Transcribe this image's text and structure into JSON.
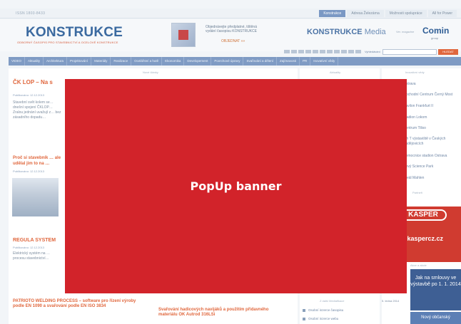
{
  "top": {
    "issn": "ISSN 1803-8433",
    "links": [
      "Konstrukce",
      "Adresa Železárna",
      "Možnosti spolupráce",
      "All for Power"
    ],
    "active_link_index": 0
  },
  "header": {
    "logo": "KONSTRUKCE",
    "logo_sub": "ODBORNÝ ČASOPIS PRO STAVEBNICTVÍ A OCELOVÉ KONSTRUKCE",
    "promo_text": "Objednávejte předplatné, tištěná vydání časopisu KONSTRUKCE",
    "promo_link": "OBJEDNAT »»",
    "media_brand": "KONSTRUKCE",
    "media_suffix": "Media",
    "partner_label": "Ver. magazine",
    "partner_logo": "Comin",
    "partner_sub": "group"
  },
  "search": {
    "extra_link": "Vyhledávání",
    "button": "HLEDAT",
    "placeholder": ""
  },
  "nav": {
    "items": [
      "VIDEO",
      "Aktuality",
      "Architektura",
      "Projektování",
      "Materiály",
      "Realizace",
      "Ocelářství a hutě",
      "Ekonomika",
      "Developement",
      "Povrchové úpravy",
      "Svařování a dělení",
      "Zajímavosti",
      "PR",
      "Inovativní vědy"
    ]
  },
  "main": {
    "section_label": "Nové články",
    "article1": {
      "title": "ČK LOP – Na s",
      "date": "Publikováno: 12.12.2013",
      "text": "Stavební svět kolem se… dnešní spojení ČKLOP… Zralou jednání uvažují z… bez zásadního dopadu…"
    },
    "article2": {
      "title": "Proč si stavebník … ale udělal jim to na …",
      "date": "Publikováno: 12.12.2013"
    },
    "article3": {
      "title": "REGULA SYSTEM",
      "date": "Publikováno: 12.12.2013",
      "text": "Elektrický systém na … procesu stavebnictví…"
    },
    "article4": {
      "title": "PATRIOTO WELDING PROCESS – software pro řízení výroby podle EN 1090 a svařování podle EN ISO 3834"
    },
    "article5": {
      "title": "Svařování hadicových navijáků a použitím přídavného materiálu OK Autrod 316LSi"
    }
  },
  "mid": {
    "section_label": "Aktuality",
    "links_label": "Z další Mediafikace",
    "links": [
      "Osobní inzerce časopisu",
      "Osobní inzerce webu"
    ]
  },
  "right": {
    "section_label": "Inovativní vědy",
    "items": [
      "Ostrava",
      "Obchodní Centrum Černý Most",
      "Pavilon Frankfurt II",
      "Stadion Lokom",
      "Centrum Tiliso",
      "Trh T výstaviště v Českých Budějovicích",
      "Nemocnice stadion Ostrava",
      "Nový Science Park",
      "Areál Mahlen"
    ],
    "partner_label": "Partneři",
    "banner_name": "KASPER",
    "banner_url": ".kaspercz.cz",
    "promo_label": "Akce a akcie",
    "promo_text": "Jak na smlouvy ve výstavbě po 1. 1. 2014",
    "promo_date": "5. ledna 2014",
    "promo2_text": "Nový občanský"
  },
  "popup": {
    "label": "PopUp banner"
  },
  "colors": {
    "popup": "#d2232a",
    "accent": "#e0673d",
    "nav": "#7f9bc4",
    "logo": "#3b6aa0"
  }
}
